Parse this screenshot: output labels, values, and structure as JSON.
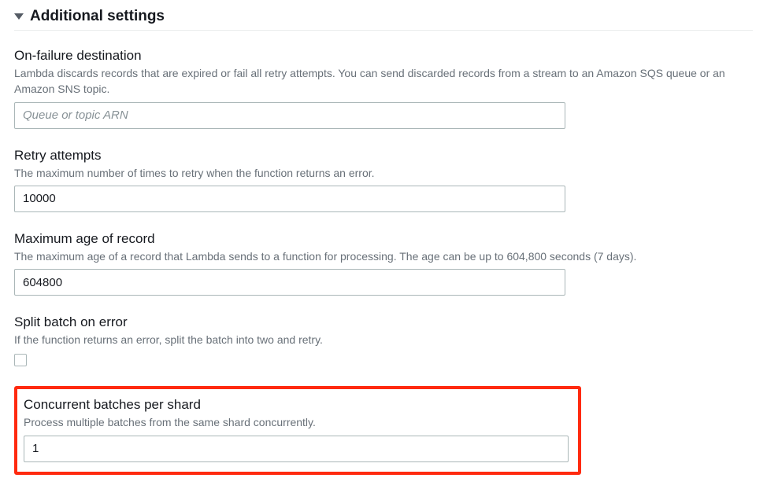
{
  "section": {
    "title": "Additional settings"
  },
  "onFailure": {
    "label": "On-failure destination",
    "desc": "Lambda discards records that are expired or fail all retry attempts. You can send discarded records from a stream to an Amazon SQS queue or an Amazon SNS topic.",
    "placeholder": "Queue or topic ARN",
    "value": ""
  },
  "retry": {
    "label": "Retry attempts",
    "desc": "The maximum number of times to retry when the function returns an error.",
    "value": "10000"
  },
  "maxAge": {
    "label": "Maximum age of record",
    "desc": "The maximum age of a record that Lambda sends to a function for processing. The age can be up to 604,800 seconds (7 days).",
    "value": "604800"
  },
  "splitBatch": {
    "label": "Split batch on error",
    "desc": "If the function returns an error, split the batch into two and retry."
  },
  "concurrent": {
    "label": "Concurrent batches per shard",
    "desc": "Process multiple batches from the same shard concurrently.",
    "value": "1"
  }
}
